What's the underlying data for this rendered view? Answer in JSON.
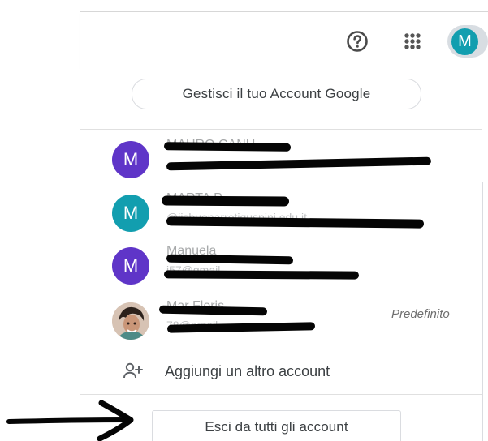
{
  "header": {
    "avatar_letter": "M",
    "help_icon": "help-circle-icon",
    "apps_icon": "apps-grid-icon"
  },
  "account_menu": {
    "manage_button_label": "Gestisci il tuo Account Google",
    "accounts": [
      {
        "avatar_letter": "M",
        "avatar_color": "#5f35c8",
        "name": "MAURO CANU",
        "email": ""
      },
      {
        "avatar_letter": "M",
        "avatar_color": "#129eaf",
        "name": "MARTA P",
        "email": "@iisbuonarrotiguspini.edu.it"
      },
      {
        "avatar_letter": "M",
        "avatar_color": "#5f35c8",
        "name": "Manuela",
        "email": "i57@gmail"
      },
      {
        "avatar_letter": "",
        "avatar_color": "#d8c4b5",
        "name": "Mar Floris",
        "email": "78@gmail",
        "status": "Predefinito"
      }
    ],
    "add_account_label": "Aggiungi un altro account",
    "sign_out_label": "Esci da tutti gli account"
  },
  "colors": {
    "accent_teal": "#129eaf",
    "accent_purple": "#5f35c8",
    "text_primary": "#3c4043",
    "divider": "#e0e0e0"
  }
}
